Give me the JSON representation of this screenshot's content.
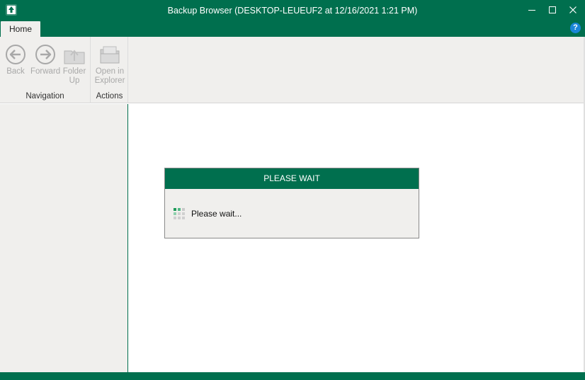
{
  "window": {
    "title": "Backup Browser (DESKTOP-LEUEUF2 at 12/16/2021 1:21 PM)",
    "minimize": "—",
    "maximize": "☐",
    "close": "✕"
  },
  "tabs": {
    "home": "Home",
    "help": "?"
  },
  "ribbon": {
    "navigation": {
      "label": "Navigation",
      "back": "Back",
      "forward": "Forward",
      "folder_up": "Folder\nUp"
    },
    "actions": {
      "label": "Actions",
      "open_in_explorer": "Open in\nExplorer"
    }
  },
  "dialog": {
    "title": "PLEASE WAIT",
    "message": "Please wait..."
  },
  "colors": {
    "brand": "#006f4e",
    "ribbon_bg": "#f0efed",
    "disabled": "#a8a8a8"
  }
}
